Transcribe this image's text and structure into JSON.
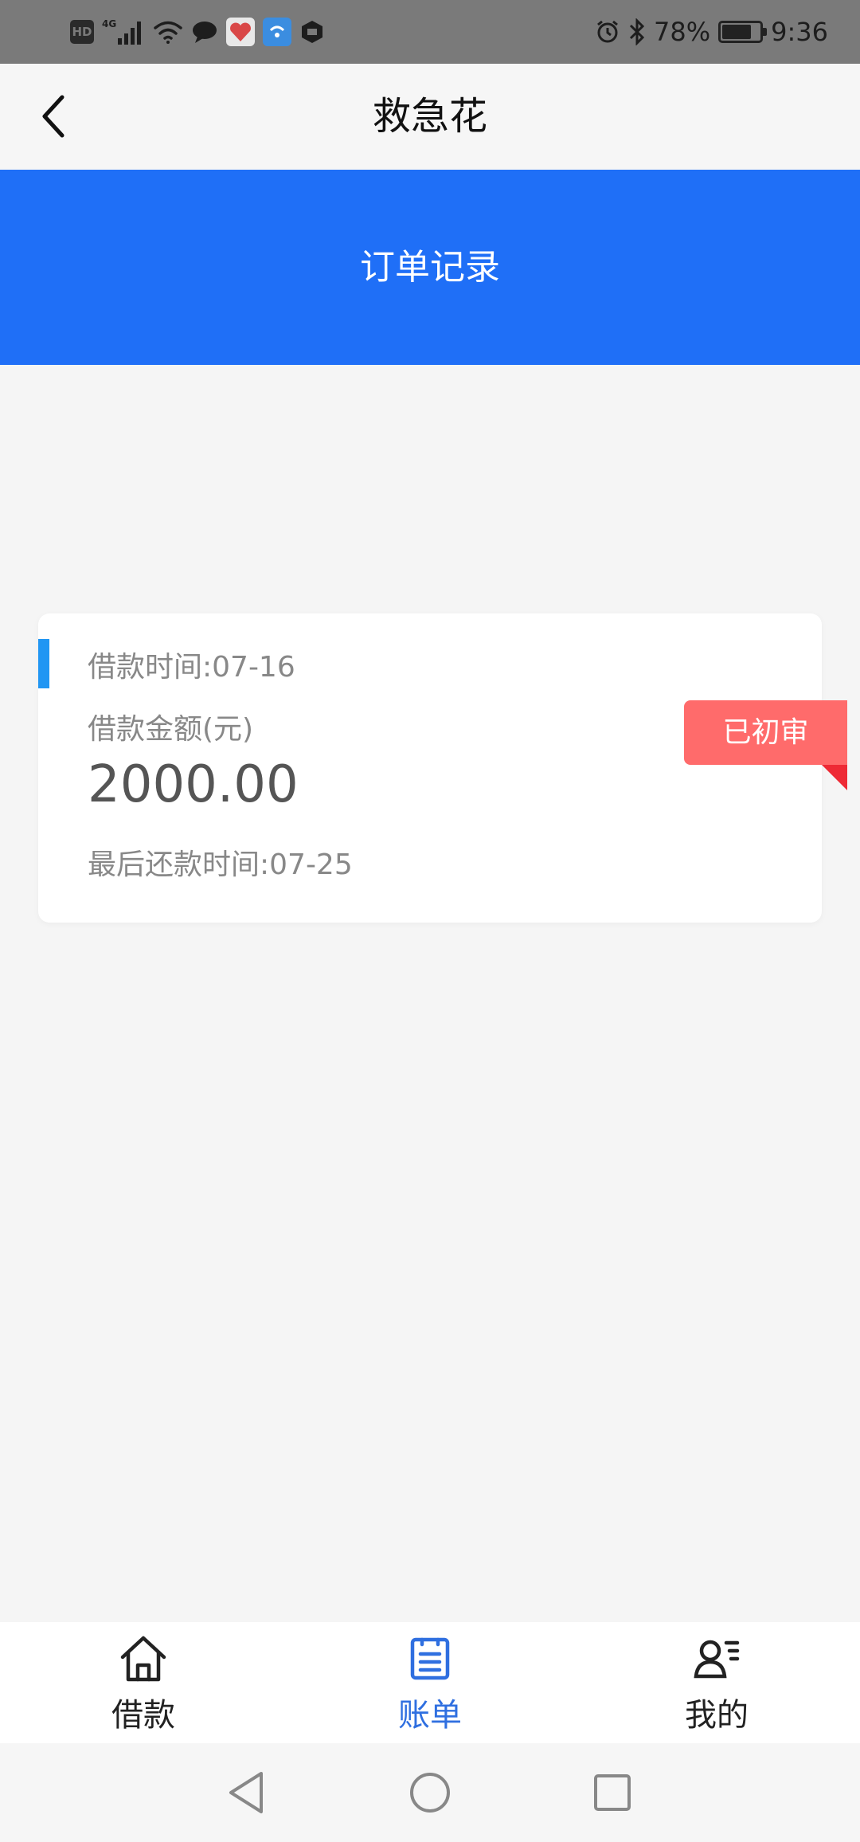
{
  "status_bar": {
    "hd": "HD",
    "network": "4G",
    "battery_percent": "78%",
    "battery_level": 0.78,
    "time": "9:36",
    "icons": [
      "hd-icon",
      "signal-4g-icon",
      "wifi-icon",
      "chat-icon",
      "app-heart-icon",
      "app-wifi-icon",
      "app-box-icon",
      "alarm-icon",
      "bluetooth-icon",
      "battery-icon"
    ]
  },
  "nav": {
    "title": "救急花",
    "back_icon": "chevron-left-icon"
  },
  "banner": {
    "title": "订单记录",
    "color": "#1f6ff7"
  },
  "order": {
    "loan_time": "借款时间:07-16",
    "amount_label": "借款金额(元)",
    "amount": "2000.00",
    "due_time": "最后还款时间:07-25",
    "status": "已初审",
    "accent_color": "#2196f3",
    "status_color": "#ff6b6b"
  },
  "tabs": [
    {
      "label": "借款",
      "icon": "home-icon",
      "active": false
    },
    {
      "label": "账单",
      "icon": "bill-icon",
      "active": true
    },
    {
      "label": "我的",
      "icon": "profile-icon",
      "active": false
    }
  ],
  "active_color": "#2f6fe0",
  "system_nav": [
    "back-triangle-icon",
    "home-circle-icon",
    "recents-square-icon"
  ]
}
